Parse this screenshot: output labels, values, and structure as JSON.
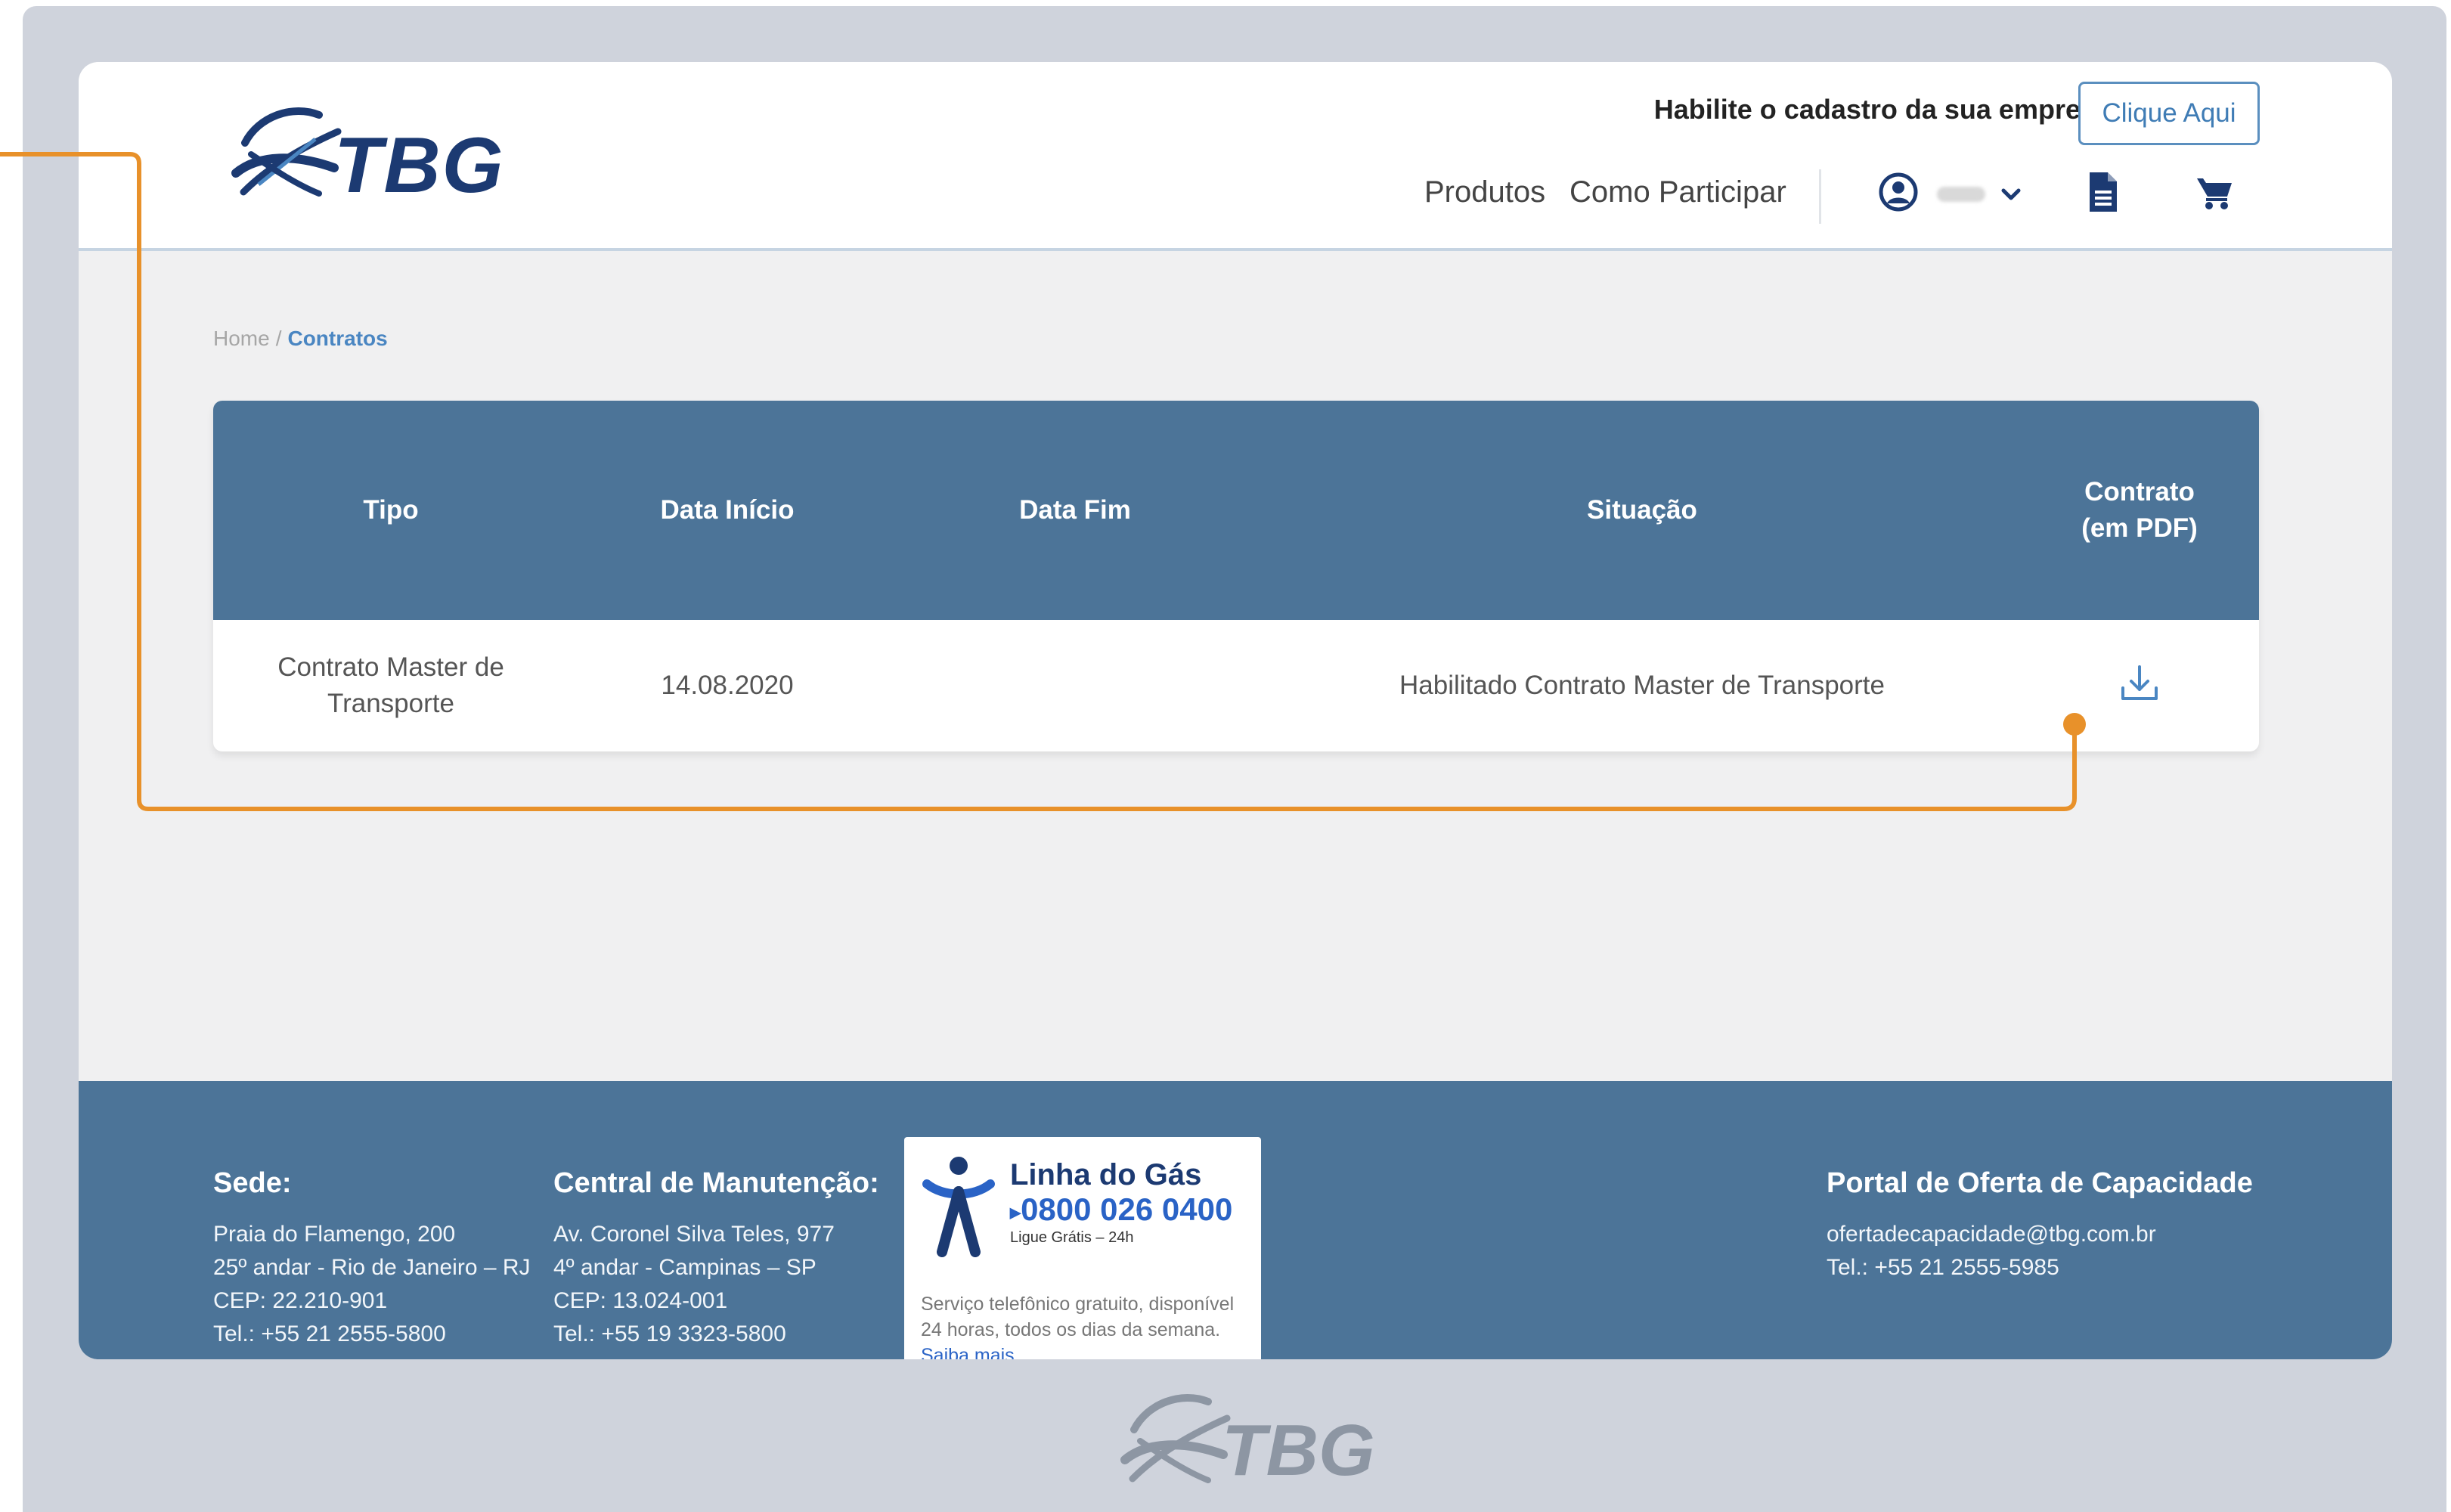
{
  "brand": {
    "logo_text": "TBG",
    "primary_color": "#4c7498",
    "accent_color": "#e8912a",
    "navy": "#1c3a72"
  },
  "header": {
    "promo_text": "Habilite o cadastro da sua empresa!",
    "promo_button": "Clique Aqui",
    "nav": [
      "Produtos",
      "Como Participar"
    ],
    "icons": [
      "user-icon",
      "chevron-down-icon",
      "document-icon",
      "cart-icon"
    ]
  },
  "breadcrumb": {
    "home": "Home",
    "separator": "/",
    "current": "Contratos"
  },
  "table": {
    "headers": [
      "Tipo",
      "Data Início",
      "Data Fim",
      "Situação",
      "Contrato\n(em PDF)"
    ],
    "rows": [
      {
        "tipo": "Contrato Master de Transporte",
        "data_inicio": "14.08.2020",
        "data_fim": "",
        "situacao": "Habilitado Contrato Master de Transporte",
        "contrato_icon": "download-icon"
      }
    ]
  },
  "footer": {
    "sede": {
      "title": "Sede:",
      "lines": [
        "Praia do Flamengo, 200",
        "25º andar - Rio de Janeiro – RJ",
        "CEP: 22.210-901",
        "Tel.: +55 21 2555-5800"
      ]
    },
    "manutencao": {
      "title": "Central de Manutenção:",
      "lines": [
        "Av. Coronel Silva Teles, 977",
        "4º andar - Campinas – SP",
        "CEP: 13.024-001",
        "Tel.: +55 19 3323-5800"
      ]
    },
    "linha_gas": {
      "title": "Linha do Gás",
      "phone": "0800 026 0400",
      "hint": "Ligue Grátis – 24h",
      "description": "Serviço telefônico gratuito, disponível 24 horas, todos os dias da semana.",
      "link": "Saiba mais"
    },
    "portal": {
      "title": "Portal de Oferta de Capacidade",
      "lines": [
        "ofertadecapacidade@tbg.com.br",
        "Tel.: +55 21 2555-5985"
      ]
    }
  }
}
